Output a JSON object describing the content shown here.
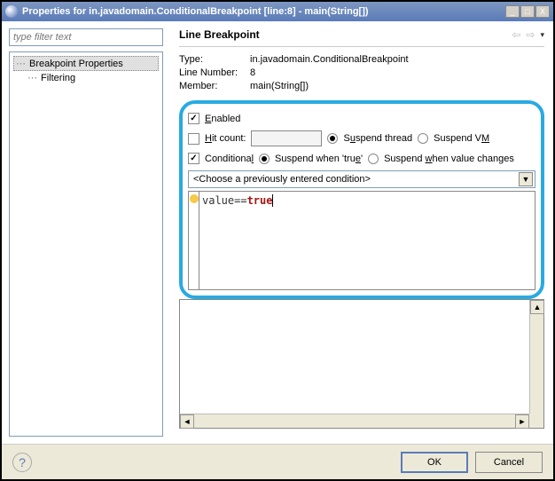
{
  "title": "Properties for in.javadomain.ConditionalBreakpoint [line:8] - main(String[])",
  "sidebar": {
    "filter_placeholder": "type filter text",
    "items": [
      "Breakpoint Properties",
      "Filtering"
    ]
  },
  "main": {
    "heading": "Line Breakpoint",
    "info": {
      "type_label": "Type:",
      "type_value": "in.javadomain.ConditionalBreakpoint",
      "line_label": "Line Number:",
      "line_value": "8",
      "member_label": "Member:",
      "member_value": "main(String[])"
    },
    "enabled_label": "Enabled",
    "hitcount_label": "Hit count:",
    "suspend_thread": "Suspend thread",
    "suspend_vm": "Suspend VM",
    "conditional_label": "Conditional",
    "suspend_true": "Suspend when 'true'",
    "suspend_change": "Suspend when value changes",
    "dropdown_text": "<Choose a previously entered condition>",
    "editor": {
      "var": "value==",
      "kw": "true"
    }
  },
  "buttons": {
    "ok": "OK",
    "cancel": "Cancel"
  }
}
